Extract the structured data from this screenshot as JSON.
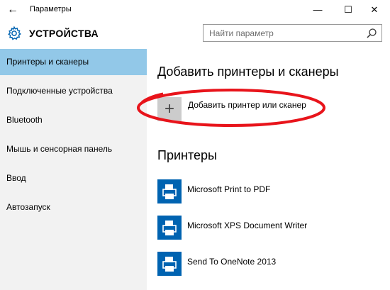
{
  "window": {
    "title": "Параметры",
    "back_glyph": "←",
    "minimize_glyph": "—",
    "maximize_glyph": "☐",
    "close_glyph": "✕"
  },
  "header": {
    "title": "УСТРОЙСТВА",
    "icon": "gear-icon"
  },
  "search": {
    "placeholder": "Найти параметр",
    "value": "",
    "icon": "search-icon"
  },
  "sidebar": {
    "items": [
      {
        "label": "Принтеры и сканеры",
        "selected": true
      },
      {
        "label": "Подключенные устройства",
        "selected": false
      },
      {
        "label": "Bluetooth",
        "selected": false
      },
      {
        "label": "Мышь и сенсорная панель",
        "selected": false
      },
      {
        "label": "Ввод",
        "selected": false
      },
      {
        "label": "Автозапуск",
        "selected": false
      }
    ],
    "selected_color": "#92c8e8",
    "background_color": "#f2f2f2"
  },
  "main": {
    "add_section_title": "Добавить принтеры и сканеры",
    "add_button_label": "Добавить принтер или сканер",
    "add_button_glyph": "+",
    "annotation_color": "#e8141b",
    "printers_title": "Принтеры",
    "printers": [
      {
        "name": "Microsoft Print to PDF",
        "icon": "printer-icon"
      },
      {
        "name": "Microsoft XPS Document Writer",
        "icon": "printer-icon"
      },
      {
        "name": "Send To OneNote 2013",
        "icon": "printer-icon"
      }
    ],
    "printer_icon_color": "#0063b1"
  }
}
